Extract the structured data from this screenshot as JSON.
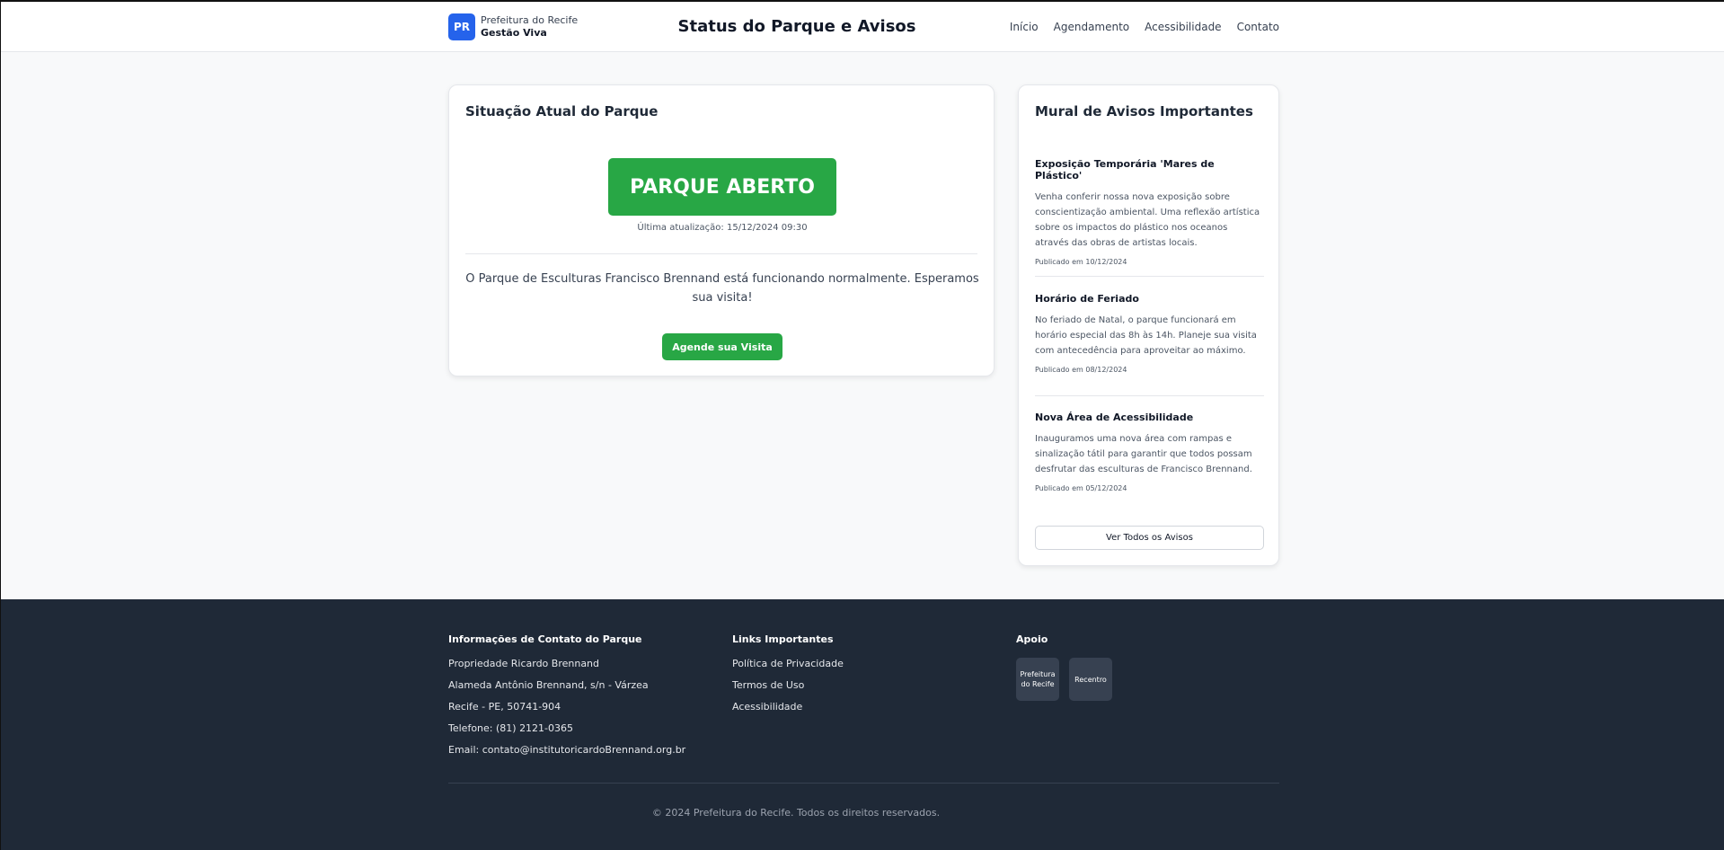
{
  "header": {
    "logo_initials": "PR",
    "brand_top": "Prefeitura do Recife",
    "brand_bottom": "Gestão Viva",
    "title": "Status do Parque e Avisos",
    "nav": [
      "Início",
      "Agendamento",
      "Acessibilidade",
      "Contato"
    ]
  },
  "status": {
    "heading": "Situação Atual do Parque",
    "badge": "PARQUE ABERTO",
    "updated": "Última atualização: 15/12/2024 09:30",
    "message": "O Parque de Esculturas Francisco Brennand está funcionando normalmente. Esperamos sua visita!",
    "button": "Agende sua Visita"
  },
  "notices": {
    "heading": "Mural de Avisos Importantes",
    "items": [
      {
        "title": "Exposição Temporária 'Mares de Plástico'",
        "body": "Venha conferir nossa nova exposição sobre conscientização ambiental. Uma reflexão artística sobre os impactos do plástico nos oceanos através das obras de artistas locais.",
        "date": "Publicado em 10/12/2024"
      },
      {
        "title": "Horário de Feriado",
        "body": "No feriado de Natal, o parque funcionará em horário especial das 8h às 14h. Planeje sua visita com antecedência para aproveitar ao máximo.",
        "date": "Publicado em 08/12/2024"
      },
      {
        "title": "Nova Área de Acessibilidade",
        "body": "Inauguramos uma nova área com rampas e sinalização tátil para garantir que todos possam desfrutar das esculturas de Francisco Brennand.",
        "date": "Publicado em 05/12/2024"
      }
    ],
    "button": "Ver Todos os Avisos"
  },
  "footer": {
    "contact_heading": "Informações de Contato do Parque",
    "contact_lines": [
      "Propriedade Ricardo Brennand",
      "Alameda Antônio Brennand, s/n - Várzea",
      "Recife - PE, 50741-904",
      "Telefone: (81) 2121-0365",
      "Email: contato@institutoricardoBrennand.org.br"
    ],
    "links_heading": "Links Importantes",
    "links": [
      "Política de Privacidade",
      "Termos de Uso",
      "Acessibilidade"
    ],
    "support_heading": "Apoio",
    "supporters": [
      "Prefeitura do Recife",
      "Recentro"
    ],
    "copyright": "© 2024 Prefeitura do Recife. Todos os direitos reservados."
  },
  "colors": {
    "brand": "#2563eb",
    "open_status": "#28a745",
    "footer_bg": "#1f2937"
  }
}
